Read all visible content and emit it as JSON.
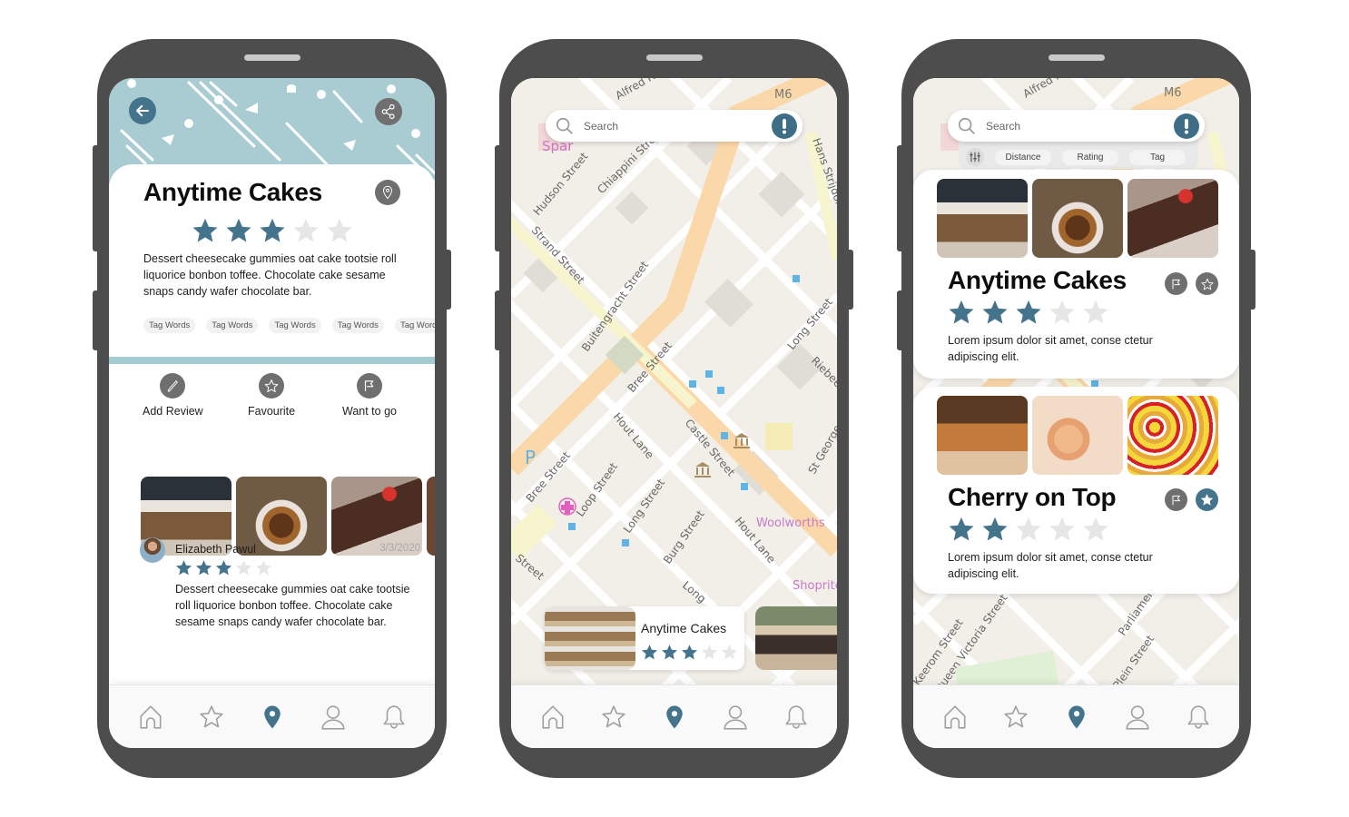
{
  "colors": {
    "accent": "#44738c",
    "star_filled": "#44738c",
    "star_empty": "#e6e6e6",
    "hero_bg": "#a9cbd2",
    "band": "#a3cdd3",
    "icon_circle": "#6f6f6f",
    "phone_frame": "#4d4d4d"
  },
  "detail_screen": {
    "back_icon": "arrow-left-icon",
    "share_icon": "share-icon",
    "title": "Anytime Cakes",
    "location_icon": "location-pin-icon",
    "rating": 3,
    "rating_max": 5,
    "description": "Dessert cheesecake gummies oat cake tootsie roll liquorice bonbon toffee. Chocolate cake sesame snaps candy wafer chocolate bar.",
    "tags": [
      "Tag Words",
      "Tag Words",
      "Tag Words",
      "Tag Words",
      "Tag Words"
    ],
    "actions": [
      {
        "label": "Add Review",
        "icon": "pencil-icon"
      },
      {
        "label": "Favourite",
        "icon": "star-icon"
      },
      {
        "label": "Want to go",
        "icon": "flag-icon"
      }
    ],
    "photos": [
      "bakery-counter",
      "cinnamon-roll",
      "chocolate-cake",
      "partial"
    ],
    "review": {
      "author": "Elizabeth Pawul",
      "date": "3/3/2020",
      "rating": 3,
      "text": "Dessert cheesecake gummies oat cake tootsie roll liquorice bonbon toffee. Chocolate cake sesame snaps candy wafer chocolate bar."
    }
  },
  "map_screen": {
    "search_placeholder": "Search",
    "alert_icon": "exclamation-icon",
    "map_labels": [
      "Alfred Road",
      "M6",
      "Spar",
      "Hudson Street",
      "Chiappini Street",
      "Hans Strijdom",
      "Strand Street",
      "Buitengracht Street",
      "Bree Street",
      "Long Street",
      "Riebeek",
      "Hout Lane",
      "Castle Street",
      "St George",
      "Loop Street",
      "Long Street",
      "Burg Street",
      "Hout Lane",
      "Woolworths",
      "Shoprite",
      "Bree Street",
      "Street",
      "Long",
      "P"
    ],
    "card": {
      "name": "Anytime Cakes",
      "rating": 3
    }
  },
  "list_screen": {
    "search_placeholder": "Search",
    "alert_icon": "exclamation-icon",
    "filter_icon": "sliders-icon",
    "filters": [
      "Distance",
      "Rating",
      "Tag"
    ],
    "map_labels": [
      "Alfred Road",
      "M6",
      "Keerom Street",
      "Queen Victoria Street",
      "Parliament",
      "Plein Street"
    ],
    "results": [
      {
        "name": "Anytime Cakes",
        "rating": 3,
        "description": "Lorem ipsum dolor sit amet, conse ctetur adipiscing elit.",
        "favourited": false,
        "photos": [
          "bakery-counter",
          "cinnamon-roll",
          "chocolate-cake"
        ]
      },
      {
        "name": "Cherry on Top",
        "rating": 2,
        "description": "Lorem ipsum dolor sit amet, conse ctetur adipiscing elit.",
        "favourited": true,
        "photos": [
          "bread-shelf",
          "doughnuts",
          "fruit-tarts"
        ]
      }
    ]
  },
  "navbar": {
    "items": [
      {
        "name": "home",
        "icon": "home-icon"
      },
      {
        "name": "favourites",
        "icon": "star-icon"
      },
      {
        "name": "map",
        "icon": "location-pin-icon",
        "active": true
      },
      {
        "name": "profile",
        "icon": "user-icon"
      },
      {
        "name": "notifications",
        "icon": "bell-icon"
      }
    ]
  }
}
